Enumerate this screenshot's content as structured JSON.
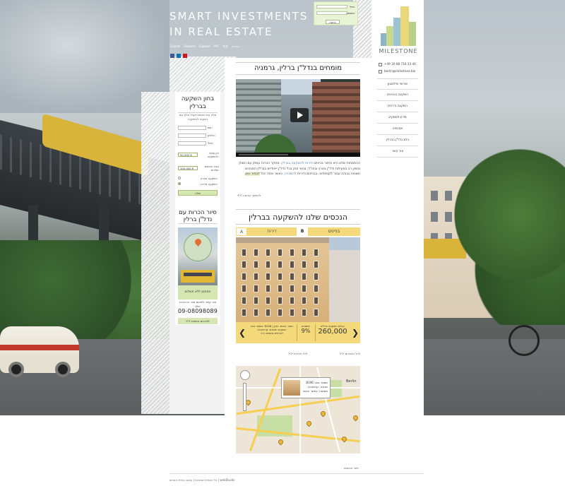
{
  "header": {
    "hero_line1": "SMART INVESTMENTS",
    "hero_line2": "IN REAL ESTATE",
    "languages": [
      "English",
      "Deutsch",
      "Español",
      "РУС",
      "中文",
      "עברית"
    ]
  },
  "login": {
    "email_label": "מייל:",
    "password_label": "סיסמה:",
    "submit_label": "כניסה"
  },
  "logo": {
    "wordmark": "MILESTONE"
  },
  "contact": {
    "phone": "+49 30 88 716 33 40",
    "email": "berlin@milestone.biz"
  },
  "menu": {
    "items": [
      "שירותי מיילסטון",
      "השקעה בבניינים",
      "השקעה בדירות",
      "מידע למשקיע",
      "אודותינו",
      "בלוג נדל\"ן בברלין",
      "צור קשר"
    ]
  },
  "main": {
    "section_title": "מומחים בנדל\"ן ברלין, גרמניה",
    "intro_text_1": "ההתמחות שלנו היא איתור בניינים ",
    "intro_link_1": "ודירות להשקעה בברלין",
    "intro_text_2": ". מחקר הכרות עמוק עם השוק וניסיון רב בפעילות נדל\"ן בארץ ובחו\"ל, בניגוי חוק בכל נדל\"ן ייחודיים בברלין המניבים תשואה גבוהה עבור לקוחותינו. בבניינים ודירות ",
    "intro_link_2": "להשכרה",
    "intro_text_3": ", כאשר אתה יכול ",
    "intro_highlight": "לבחור נכון",
    "intro_text_4": ".",
    "read_more": "<< להמשך קריאה"
  },
  "properties": {
    "section_title": "הנכסים שלנו להשקעה בברלין",
    "tab_a": "A",
    "tab_apartments": "דירות",
    "tab_b": "B",
    "tab_buildings": "בניינים",
    "price_label": "עלות השקעה כוללת:",
    "price_value": "260,000",
    "yield_label": "תשואה:",
    "yield_value": "9%",
    "details": "מספר נכס: B106 | תאור הנכס: בניין השקעה שכונת: קרויצברג",
    "more_details": "<< לפרטים נוספים",
    "link_all_buildings": "לכל הבניינים <<",
    "link_all_apartments": "לכל הדירות <<"
  },
  "map": {
    "popup_line1": "מספר נכס: B106",
    "popup_line2": "שכונה: קרויצברג",
    "popup_line3": "תשואה: באשר הנכס",
    "city_label": "Berlin",
    "bottom_link": "תיור הנכסים"
  },
  "left_form": {
    "title": "בחון השקעה בברלין",
    "description": "מלא את הטופס וקבל אליך עם הצעות להשקעה",
    "name_label": "שם:",
    "phone_label": "טלפון:",
    "email_label": "מייל:",
    "invest_range_label": "הון עצמי להשקעה:",
    "invest_range_value": "50,000 €",
    "total_range_label": "גובה הנכסים שלהם:",
    "total_range_value": "100,000 €",
    "radio_building": "השקעה בבניין",
    "radio_apartment": "השקעה בדירה",
    "submit": "שלח"
  },
  "left_tour": {
    "title": "סיור הכרות עם נדל\"ן ברלין",
    "free_label": "המוזמן ללא תשלום",
    "description": "צור קשר לתיאום סיור ההיכרות שלך:",
    "phone": "09-08098089",
    "more_details": "<< לפרטים נוספים"
  },
  "footer": {
    "text": "כל הזכויות שמורות | עיצוב ובניית אתרים | webStudio"
  },
  "colors": {
    "accent_yellow": "#f4d97a",
    "accent_green": "#d5e6b2",
    "text_dark": "#222222"
  }
}
